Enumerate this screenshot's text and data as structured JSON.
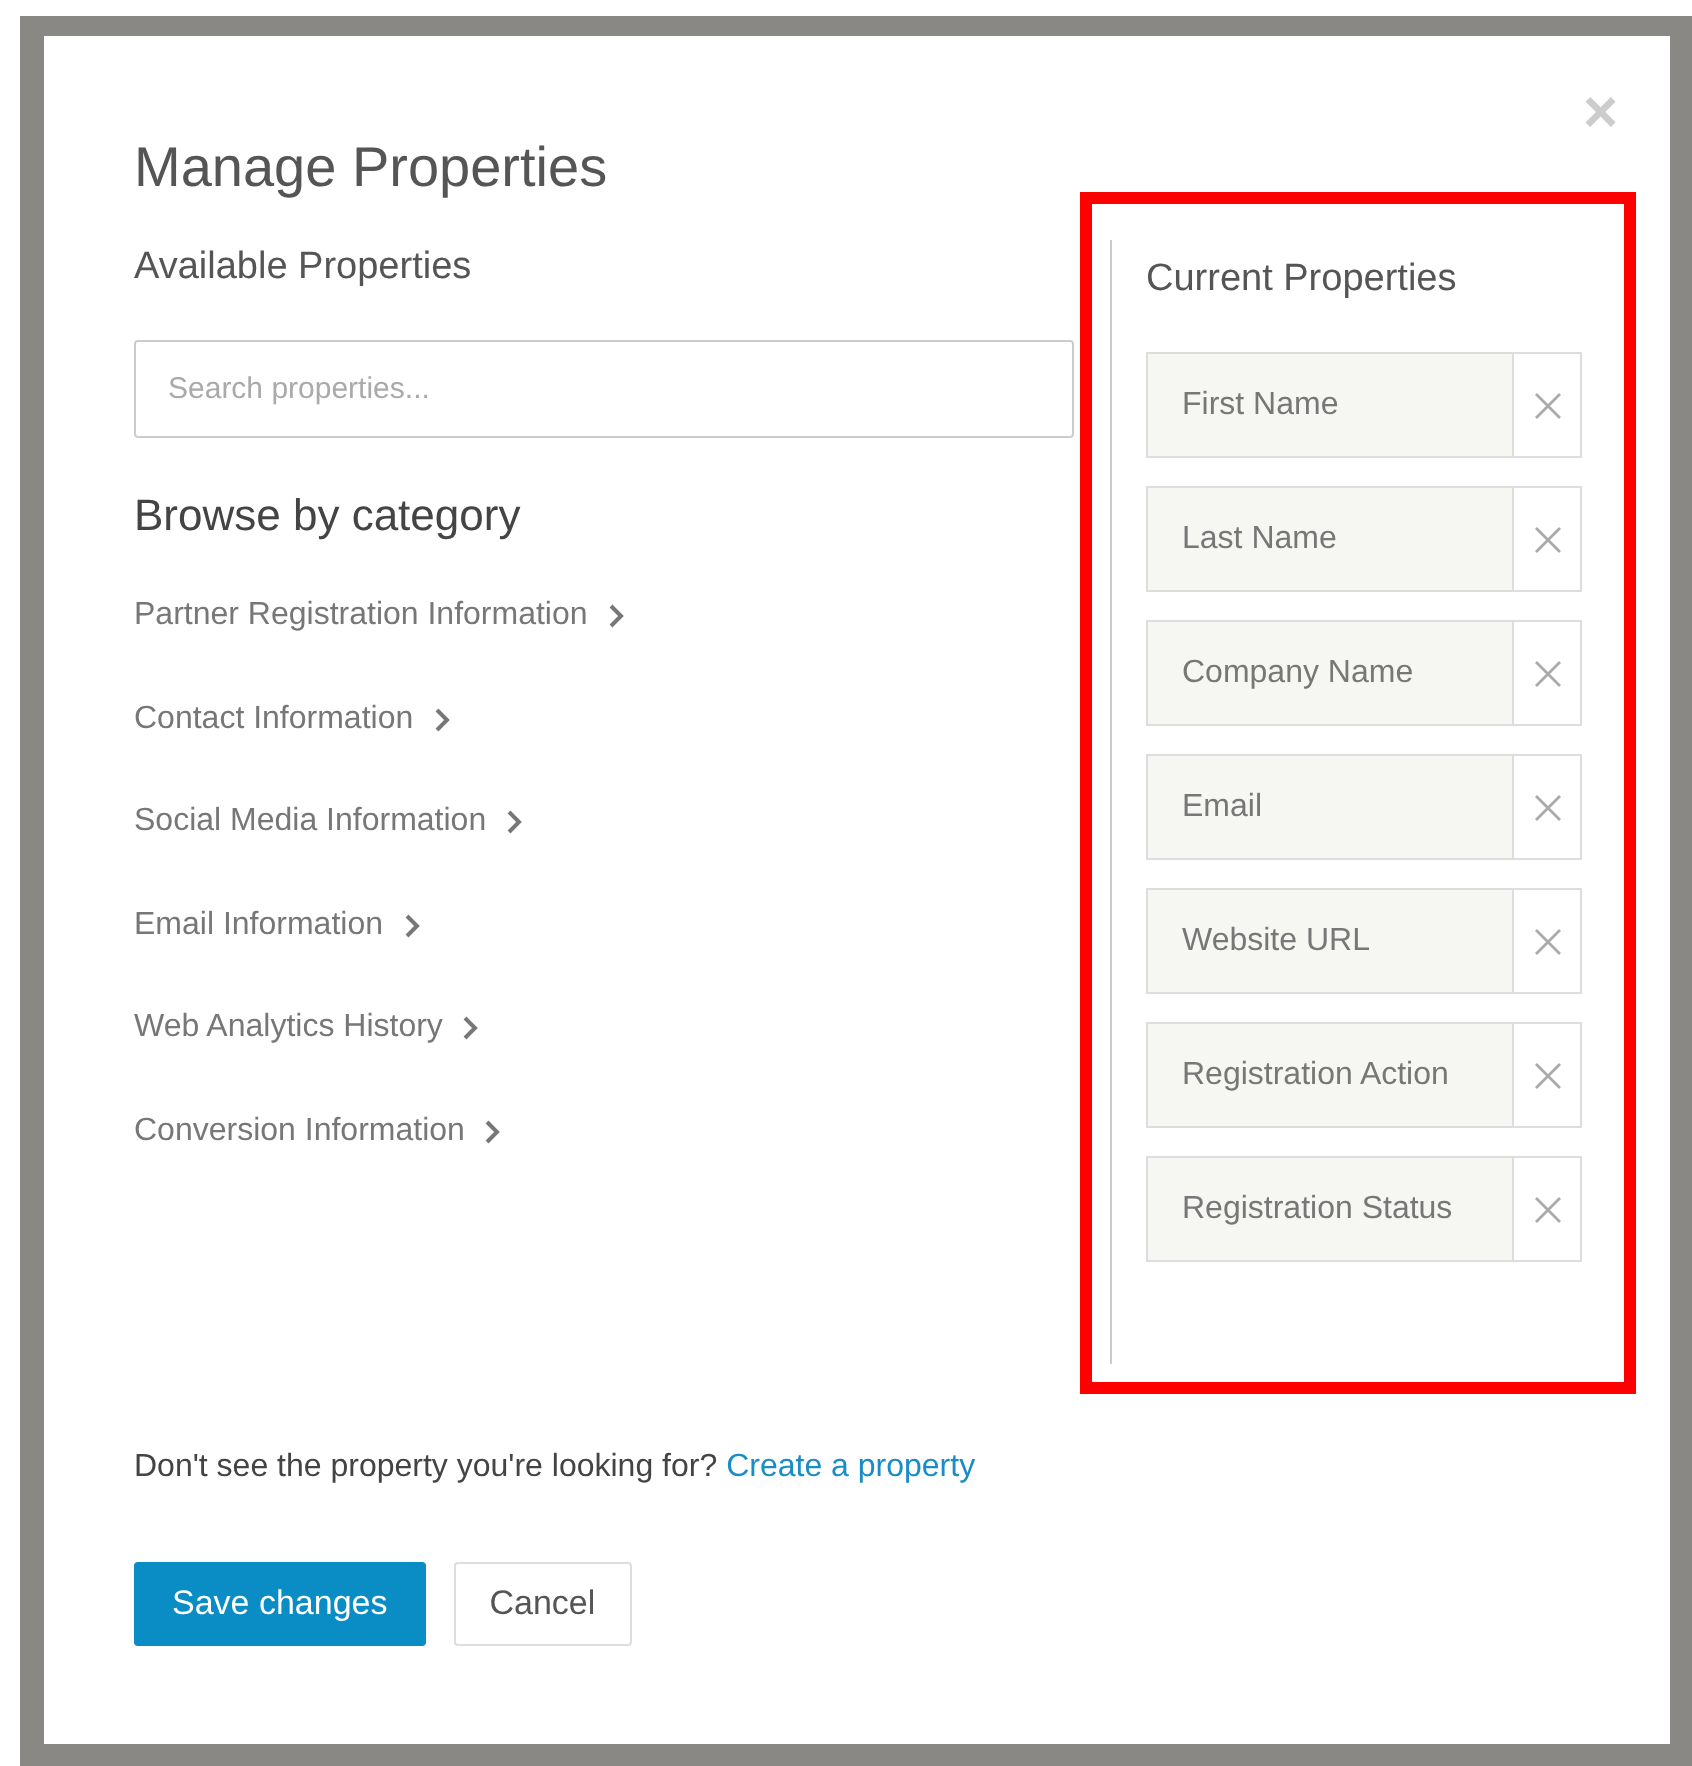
{
  "dialog": {
    "title": "Manage Properties",
    "close": "×"
  },
  "available": {
    "heading": "Available Properties",
    "search": {
      "placeholder": "Search properties..."
    },
    "browse_heading": "Browse by category",
    "categories": [
      {
        "label": "Partner Registration Information"
      },
      {
        "label": "Contact Information"
      },
      {
        "label": "Social Media Information"
      },
      {
        "label": "Email Information"
      },
      {
        "label": "Web Analytics History"
      },
      {
        "label": "Conversion Information"
      }
    ]
  },
  "current": {
    "heading": "Current Properties",
    "highlighted": true,
    "items": [
      {
        "label": "First Name"
      },
      {
        "label": "Last Name"
      },
      {
        "label": "Company Name"
      },
      {
        "label": "Email"
      },
      {
        "label": "Website URL"
      },
      {
        "label": "Registration Action"
      },
      {
        "label": "Registration Status"
      }
    ]
  },
  "footer": {
    "prompt": "Don't see the property you're looking for?",
    "link": "Create a property"
  },
  "buttons": [
    {
      "label": "Save changes",
      "kind": "primary"
    },
    {
      "label": "Cancel",
      "kind": "secondary"
    }
  ]
}
